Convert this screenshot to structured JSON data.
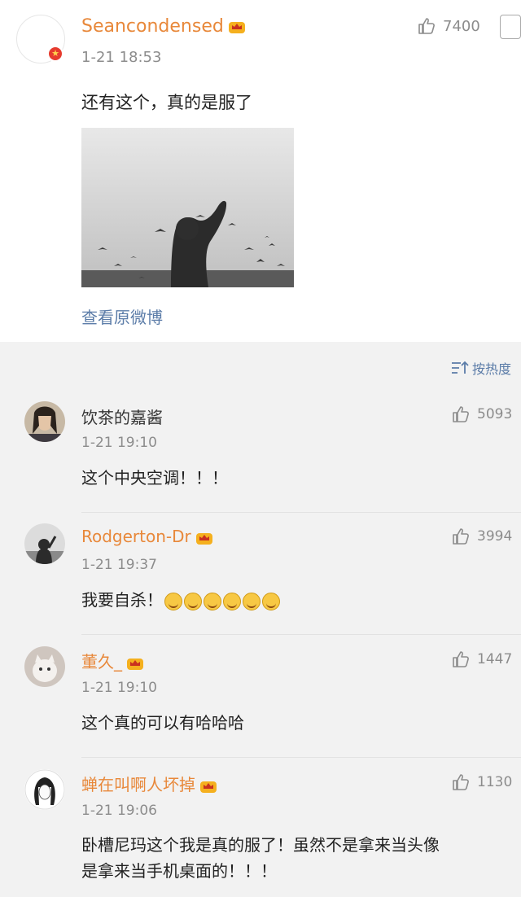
{
  "post": {
    "username": "Seancondensed",
    "time": "1-21 18:53",
    "likes": "7400",
    "text": "还有这个，真的是服了",
    "view_original": "查看原微博"
  },
  "sort_label": "按热度",
  "comments": [
    {
      "username": "饮茶的嘉酱",
      "time": "1-21 19:10",
      "text": "这个中央空调！！！",
      "likes": "5093"
    },
    {
      "username": "Rodgerton-Dr",
      "time": "1-21 19:37",
      "text": "我要自杀！",
      "likes": "3994"
    },
    {
      "username": "董久_",
      "time": "1-21 19:10",
      "text": "这个真的可以有哈哈哈",
      "likes": "1447"
    },
    {
      "username": "蝉在叫啊人坏掉",
      "time": "1-21 19:06",
      "text_line1": "卧槽尼玛这个我是真的服了！虽然不是拿来当头像",
      "text_line2": "是拿来当手机桌面的！！！",
      "likes": "1130"
    }
  ],
  "colors": {
    "username_vip": "#e8883a",
    "username_normal": "#333333",
    "link": "#5b7ca8",
    "meta": "#8c8c8c"
  },
  "icons": [
    "thumbs-up-icon",
    "crown-icon",
    "sort-icon",
    "verified-badge-icon",
    "emoji-icon"
  ]
}
